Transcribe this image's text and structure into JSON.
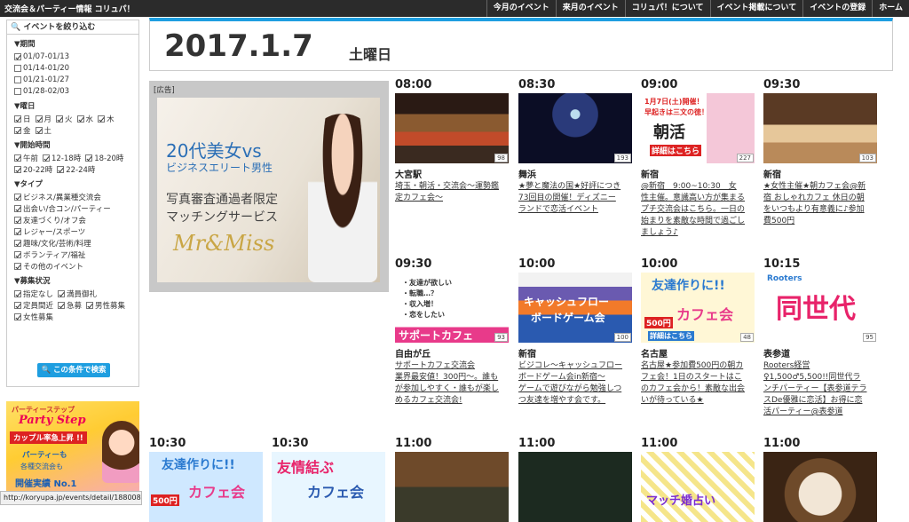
{
  "header": {
    "site_title": "交流会＆パーティー情報 コリュパ！",
    "nav": [
      "今月のイベント",
      "来月のイベント",
      "コリュパ！について",
      "イベント掲載について",
      "イベントの登録",
      "ホーム"
    ]
  },
  "sidebar": {
    "heading": "イベントを絞り込む",
    "period": {
      "title": "▼期間",
      "options": [
        {
          "label": "01/07-01/13",
          "checked": true
        },
        {
          "label": "01/14-01/20",
          "checked": false
        },
        {
          "label": "01/21-01/27",
          "checked": false
        },
        {
          "label": "01/28-02/03",
          "checked": false
        }
      ]
    },
    "weekday": {
      "title": "▼曜日",
      "options": [
        {
          "label": "日",
          "checked": true
        },
        {
          "label": "月",
          "checked": true
        },
        {
          "label": "火",
          "checked": true
        },
        {
          "label": "水",
          "checked": true
        },
        {
          "label": "木",
          "checked": true
        },
        {
          "label": "金",
          "checked": true
        },
        {
          "label": "土",
          "checked": true
        }
      ]
    },
    "start_time": {
      "title": "▼開始時間",
      "options": [
        {
          "label": "午前",
          "checked": true
        },
        {
          "label": "12-18時",
          "checked": true
        },
        {
          "label": "18-20時",
          "checked": true
        },
        {
          "label": "20-22時",
          "checked": true
        },
        {
          "label": "22-24時",
          "checked": true
        }
      ]
    },
    "type": {
      "title": "▼タイプ",
      "options": [
        {
          "label": "ビジネス/異業種交流会",
          "checked": true
        },
        {
          "label": "出会い/合コン/パーティー",
          "checked": true
        },
        {
          "label": "友達づくり/オフ会",
          "checked": true
        },
        {
          "label": "レジャー/スポーツ",
          "checked": true
        },
        {
          "label": "趣味/文化/芸術/料理",
          "checked": true
        },
        {
          "label": "ボランティア/福祉",
          "checked": true
        },
        {
          "label": "その他のイベント",
          "checked": true
        }
      ]
    },
    "status": {
      "title": "▼募集状況",
      "options": [
        {
          "label": "指定なし",
          "checked": true
        },
        {
          "label": "満員御礼",
          "checked": true
        },
        {
          "label": "定員間近",
          "checked": true
        },
        {
          "label": "急募",
          "checked": true
        },
        {
          "label": "男性募集",
          "checked": true
        },
        {
          "label": "女性募集",
          "checked": true
        }
      ]
    },
    "search_button": "この条件で検索",
    "banner": {
      "l1": "パーティーステップ",
      "l2": "Party Step",
      "l3": "カップル率急上昇 !!",
      "l4": "パーティーも",
      "l5": "各種交流会も",
      "l6": "開催実績 No.1"
    }
  },
  "status_url": "http://koryupa.jp/events/detail/188008",
  "date_header": {
    "date": "2017.1.7",
    "weekday": "土曜日"
  },
  "ad": {
    "label": "[広告]",
    "line1": "20代美女vs",
    "line2": "ビジネスエリート男性",
    "line3": "写真審査通過者限定",
    "line4": "マッチングサービス",
    "line5": "Mr&Miss"
  },
  "events": [
    {
      "time": "08:00",
      "place": "大宮駅",
      "title": "埼玉・朝活・交流会〜運勢鑑\n定カフェ会〜",
      "count": "98"
    },
    {
      "time": "08:30",
      "place": "舞浜",
      "title": "★夢と魔法の国★好評につき\n73回目の開催！ディズニー\nランドで恋活イベント",
      "count": "193"
    },
    {
      "time": "09:00",
      "place": "新宿",
      "title": "@新宿　9:00~10:30　女\n性主催。意識高い方が集まる\nプチ交流会はこちら。一日の\n始まりを素敵な時間で過ごし\nましょう♪",
      "count": "227"
    },
    {
      "time": "09:30",
      "place": "新宿",
      "title": "★女性主催★朝カフェ会@新\n宿 おしゃれカフェ 休日の朝\nをいつもより有意義に♪参加\n費500円",
      "count": "103"
    },
    {
      "time": "09:30",
      "place": "自由が丘",
      "title": "サポートカフェ交流会\n業界最安値！300円〜。誰も\nが参加しやすく・誰もが楽し\nめるカフェ交流会!",
      "count": "93"
    },
    {
      "time": "10:00",
      "place": "新宿",
      "title": "ビジコレ〜キャッシュフロー\nボードゲーム会in新宿〜\nゲームで遊びながら勉強しつ\nつ友達を増やす会です。",
      "count": "100"
    },
    {
      "time": "10:00",
      "place": "名古屋",
      "title": "名古屋★参加費500円の朝カ\nフェ会！1日のスタートはこ\nのカフェ会から！素敵な出会\nいが待っている★",
      "count": "48"
    },
    {
      "time": "10:15",
      "place": "表参道",
      "title": "Rooters経営\n♀1,500♂5,500!!同世代ラ\nンチパーティー【表参道テラ\nスDe優雅に恋活】お得に恋\n活パーティー@表参道",
      "count": "95"
    },
    {
      "time": "10:30",
      "place": "",
      "title": "",
      "count": ""
    },
    {
      "time": "10:30",
      "place": "",
      "title": "",
      "count": ""
    },
    {
      "time": "11:00",
      "place": "",
      "title": "",
      "count": ""
    },
    {
      "time": "11:00",
      "place": "",
      "title": "",
      "count": ""
    },
    {
      "time": "11:00",
      "place": "",
      "title": "",
      "count": ""
    },
    {
      "time": "11:00",
      "place": "",
      "title": "",
      "count": ""
    }
  ],
  "thumb_text": {
    "e2_a": "1月7日(土)開催！",
    "e2_b": "早起きは三文の徳！",
    "e2_c": "朝活",
    "e2_d": "詳細はこちら",
    "e4_a": "・友達が欲しい",
    "e4_b": "・転職…？",
    "e4_c": "・収入増！",
    "e4_d": "・恋をしたい",
    "e4_e": "サポートカフェ",
    "e5_a": "キャッシュフロー",
    "e5_b": "ボードゲーム会",
    "e6_a": "友達作りに!!",
    "e6_b": "カフェ会",
    "e6_c": "500円",
    "e6_d": "詳細はこちら",
    "e7_a": "Rooters",
    "e7_b": "同世代",
    "e8_a": "友達作りに!!",
    "e8_b": "カフェ会",
    "e8_c": "500円",
    "e9_a": "友情結ぶ",
    "e9_b": "カフェ会",
    "e12_a": "マッチ婚占い"
  }
}
